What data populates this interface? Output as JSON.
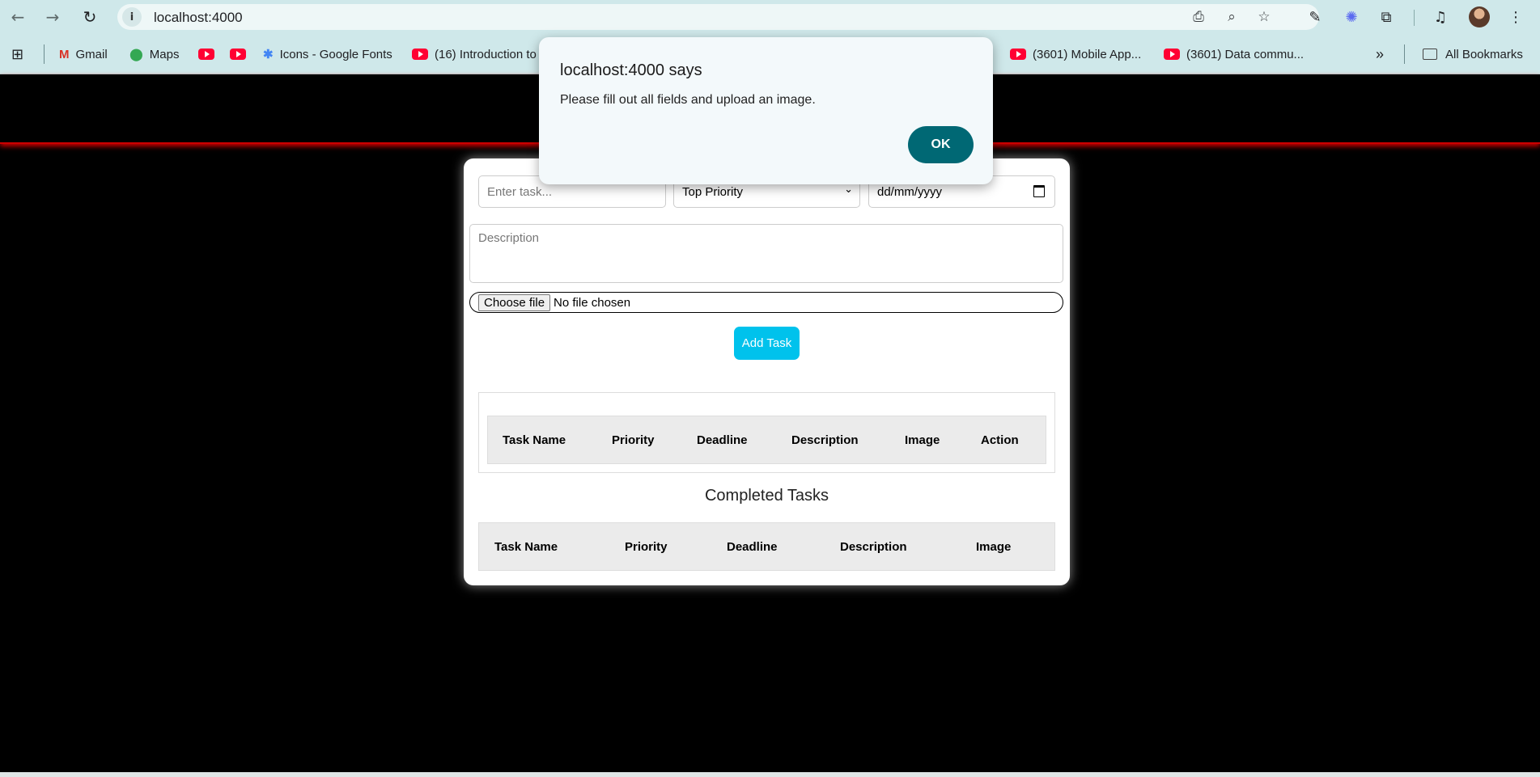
{
  "browser": {
    "url": "localhost:4000",
    "bookmarks": [
      {
        "label": "Gmail",
        "icon": "gmail-icon"
      },
      {
        "label": "Maps",
        "icon": "maps-icon"
      },
      {
        "label": "",
        "icon": "youtube-icon"
      },
      {
        "label": "",
        "icon": "youtube-icon"
      },
      {
        "label": "Icons - Google Fonts",
        "icon": "google-fonts-icon"
      },
      {
        "label": "(16) Introduction to",
        "icon": "youtube-icon"
      },
      {
        "label": "(3601) Mobile App...",
        "icon": "youtube-icon"
      },
      {
        "label": "(3601) Data commu...",
        "icon": "youtube-icon"
      }
    ],
    "more_bookmarks": "»",
    "all_bookmarks": "All Bookmarks",
    "colors": {
      "chrome_bg": "#cfe8ea",
      "omnibox_bg": "#eef7f7"
    }
  },
  "form": {
    "task_placeholder": "Enter task...",
    "priority_selected": "Top Priority",
    "deadline_placeholder": "dd/mm/yyyy",
    "description_placeholder": "Description",
    "file_button": "Choose file",
    "file_status": "No file chosen",
    "add_button": "Add Task",
    "colors": {
      "add_button": "#00c2ec"
    }
  },
  "tasks_table": {
    "headers": [
      "Task Name",
      "Priority",
      "Deadline",
      "Description",
      "Image",
      "Action"
    ]
  },
  "completed": {
    "title": "Completed Tasks",
    "headers": [
      "Task Name",
      "Priority",
      "Deadline",
      "Description",
      "Image"
    ]
  },
  "dialog": {
    "title": "localhost:4000 says",
    "message": "Please fill out all fields and upload an image.",
    "ok": "OK",
    "colors": {
      "ok_button": "#006874"
    }
  }
}
